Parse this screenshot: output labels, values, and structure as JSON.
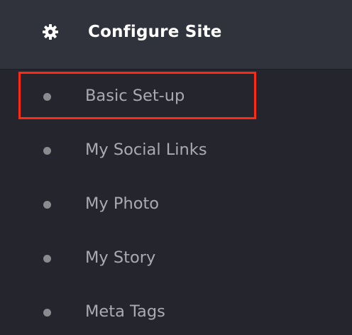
{
  "header": {
    "title": "Configure Site",
    "icon": "gear-icon"
  },
  "menu": {
    "bullet_icon": "bullet-dot-icon",
    "items": [
      {
        "label": "Basic Set-up",
        "highlighted": true
      },
      {
        "label": "My Social Links",
        "highlighted": false
      },
      {
        "label": "My Photo",
        "highlighted": false
      },
      {
        "label": "My Story",
        "highlighted": false
      },
      {
        "label": "Meta Tags",
        "highlighted": false
      }
    ]
  },
  "colors": {
    "background": "#25262d",
    "header_background": "#30333b",
    "title_text": "#ffffff",
    "item_text": "#a9abb0",
    "bullet": "#8a8b8f",
    "highlight_border": "#ff2a14"
  }
}
